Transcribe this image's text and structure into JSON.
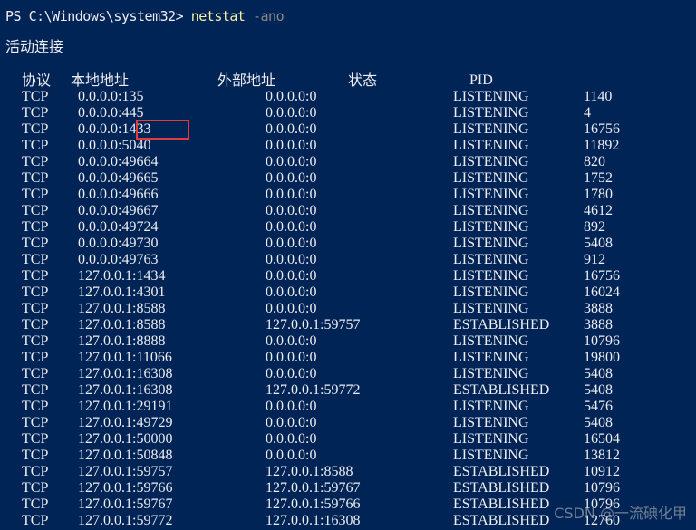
{
  "prompt": {
    "path": "PS C:\\Windows\\system32> ",
    "command": "netstat",
    "args": " -ano"
  },
  "section_title": "活动连接",
  "columns": {
    "proto": "协议",
    "local": "本地地址",
    "foreign": "外部地址",
    "state": "状态",
    "pid": "PID"
  },
  "rows": [
    {
      "proto": "TCP",
      "local": "0.0.0.0:135",
      "foreign": "0.0.0.0:0",
      "state": "LISTENING",
      "pid": "1140"
    },
    {
      "proto": "TCP",
      "local": "0.0.0.0:445",
      "foreign": "0.0.0.0:0",
      "state": "LISTENING",
      "pid": "4"
    },
    {
      "proto": "TCP",
      "local": "0.0.0.0:1433",
      "foreign": "0.0.0.0:0",
      "state": "LISTENING",
      "pid": "16756"
    },
    {
      "proto": "TCP",
      "local": "0.0.0.0:5040",
      "foreign": "0.0.0.0:0",
      "state": "LISTENING",
      "pid": "11892"
    },
    {
      "proto": "TCP",
      "local": "0.0.0.0:49664",
      "foreign": "0.0.0.0:0",
      "state": "LISTENING",
      "pid": "820"
    },
    {
      "proto": "TCP",
      "local": "0.0.0.0:49665",
      "foreign": "0.0.0.0:0",
      "state": "LISTENING",
      "pid": "1752"
    },
    {
      "proto": "TCP",
      "local": "0.0.0.0:49666",
      "foreign": "0.0.0.0:0",
      "state": "LISTENING",
      "pid": "1780"
    },
    {
      "proto": "TCP",
      "local": "0.0.0.0:49667",
      "foreign": "0.0.0.0:0",
      "state": "LISTENING",
      "pid": "4612"
    },
    {
      "proto": "TCP",
      "local": "0.0.0.0:49724",
      "foreign": "0.0.0.0:0",
      "state": "LISTENING",
      "pid": "892"
    },
    {
      "proto": "TCP",
      "local": "0.0.0.0:49730",
      "foreign": "0.0.0.0:0",
      "state": "LISTENING",
      "pid": "5408"
    },
    {
      "proto": "TCP",
      "local": "0.0.0.0:49763",
      "foreign": "0.0.0.0:0",
      "state": "LISTENING",
      "pid": "912"
    },
    {
      "proto": "TCP",
      "local": "127.0.0.1:1434",
      "foreign": "0.0.0.0:0",
      "state": "LISTENING",
      "pid": "16756"
    },
    {
      "proto": "TCP",
      "local": "127.0.0.1:4301",
      "foreign": "0.0.0.0:0",
      "state": "LISTENING",
      "pid": "16024"
    },
    {
      "proto": "TCP",
      "local": "127.0.0.1:8588",
      "foreign": "0.0.0.0:0",
      "state": "LISTENING",
      "pid": "3888"
    },
    {
      "proto": "TCP",
      "local": "127.0.0.1:8588",
      "foreign": "127.0.0.1:59757",
      "state": "ESTABLISHED",
      "pid": "3888"
    },
    {
      "proto": "TCP",
      "local": "127.0.0.1:8888",
      "foreign": "0.0.0.0:0",
      "state": "LISTENING",
      "pid": "10796"
    },
    {
      "proto": "TCP",
      "local": "127.0.0.1:11066",
      "foreign": "0.0.0.0:0",
      "state": "LISTENING",
      "pid": "19800"
    },
    {
      "proto": "TCP",
      "local": "127.0.0.1:16308",
      "foreign": "0.0.0.0:0",
      "state": "LISTENING",
      "pid": "5408"
    },
    {
      "proto": "TCP",
      "local": "127.0.0.1:16308",
      "foreign": "127.0.0.1:59772",
      "state": "ESTABLISHED",
      "pid": "5408"
    },
    {
      "proto": "TCP",
      "local": "127.0.0.1:29191",
      "foreign": "0.0.0.0:0",
      "state": "LISTENING",
      "pid": "5476"
    },
    {
      "proto": "TCP",
      "local": "127.0.0.1:49729",
      "foreign": "0.0.0.0:0",
      "state": "LISTENING",
      "pid": "5408"
    },
    {
      "proto": "TCP",
      "local": "127.0.0.1:50000",
      "foreign": "0.0.0.0:0",
      "state": "LISTENING",
      "pid": "16504"
    },
    {
      "proto": "TCP",
      "local": "127.0.0.1:50848",
      "foreign": "0.0.0.0:0",
      "state": "LISTENING",
      "pid": "13812"
    },
    {
      "proto": "TCP",
      "local": "127.0.0.1:59757",
      "foreign": "127.0.0.1:8588",
      "state": "ESTABLISHED",
      "pid": "10912"
    },
    {
      "proto": "TCP",
      "local": "127.0.0.1:59766",
      "foreign": "127.0.0.1:59767",
      "state": "ESTABLISHED",
      "pid": "10796"
    },
    {
      "proto": "TCP",
      "local": "127.0.0.1:59767",
      "foreign": "127.0.0.1:59766",
      "state": "ESTABLISHED",
      "pid": "10796"
    },
    {
      "proto": "TCP",
      "local": "127.0.0.1:59772",
      "foreign": "127.0.0.1:16308",
      "state": "ESTABLISHED",
      "pid": "12760"
    }
  ],
  "watermark": "CSDN @一流碘化甲",
  "colors": {
    "background": "#012456",
    "text": "#eeedf0",
    "command": "#f9f1a5",
    "argument": "#8a8a8a",
    "highlight_border": "#e23b3b"
  }
}
